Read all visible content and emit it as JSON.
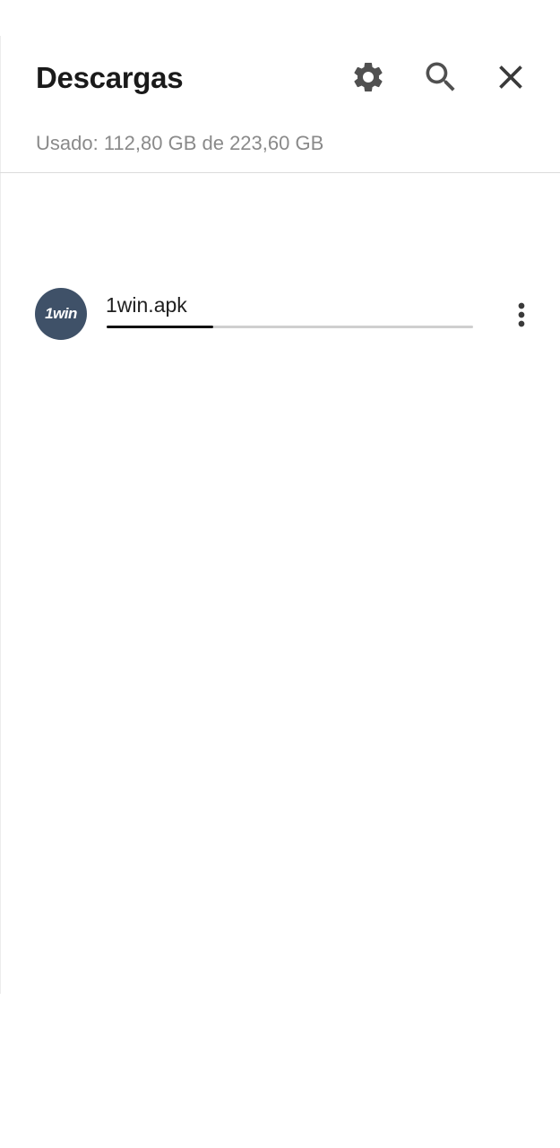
{
  "header": {
    "title": "Descargas",
    "storage_text": "Usado: 112,80 GB de 223,60 GB"
  },
  "toolbar": {
    "icons": [
      "gear-icon",
      "search-icon",
      "close-icon"
    ]
  },
  "downloads": [
    {
      "avatar_text": "1win",
      "file_name": "1win.apk",
      "progress": 0.29,
      "menu_icon": "more-vert-icon"
    }
  ],
  "colors": {
    "avatar_bg": "#3f5168",
    "progress_fill": "#111111",
    "progress_track": "#cfcfcf",
    "icon": "#505050"
  }
}
